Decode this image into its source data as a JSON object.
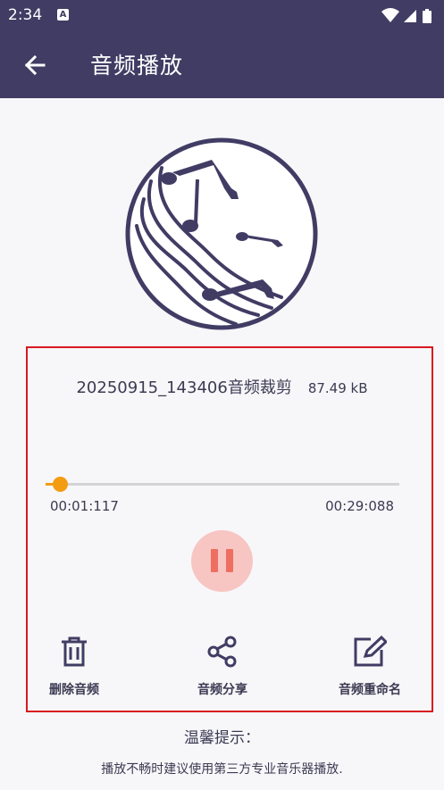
{
  "status_bar": {
    "time": "2:34",
    "notification_icon": "A",
    "icons": [
      "wifi-icon",
      "signal-icon",
      "battery-icon"
    ]
  },
  "app_bar": {
    "title": "音频播放",
    "back_icon": "arrow-left-icon"
  },
  "player": {
    "artwork_icon": "music-notes-disc-icon",
    "file_name": "20250915_143406音频裁剪",
    "file_size": "87.49 kB",
    "current_time": "00:01:117",
    "total_time": "00:29:088",
    "progress_fraction": 0.04,
    "state": "playing",
    "pause_icon": "pause-icon"
  },
  "actions": [
    {
      "label": "删除音频",
      "icon": "trash-icon"
    },
    {
      "label": "音频分享",
      "icon": "share-icon"
    },
    {
      "label": "音频重命名",
      "icon": "edit-icon"
    }
  ],
  "tips": {
    "title": "温馨提示：",
    "text": "播放不畅时建议使用第三方专业音乐器播放."
  },
  "colors": {
    "primary": "#413c64",
    "accent": "#f39c12",
    "pause_bg": "#f7c6c2",
    "pause_icon": "#ee6f61",
    "highlight_border": "#d71920",
    "background": "#f7f7f9"
  }
}
